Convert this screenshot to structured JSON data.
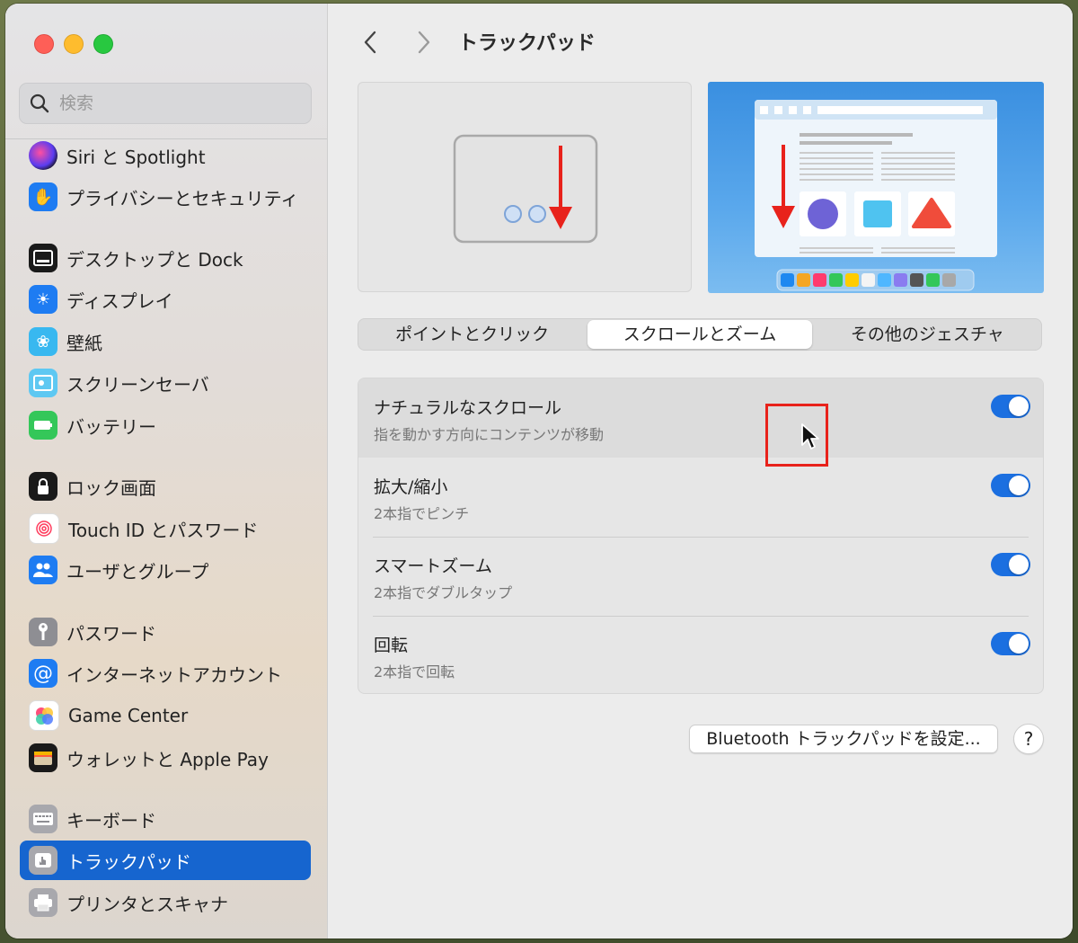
{
  "window": {
    "colors": {
      "accent": "#1665cf",
      "toggle_on": "#1b6fe0",
      "highlight_box": "#e8221b"
    }
  },
  "sidebar": {
    "search_placeholder": "検索",
    "items": [
      {
        "label": "Siri と Spotlight",
        "icon": "siri-icon",
        "selected": false
      },
      {
        "label": "プライバシーとセキュリティ",
        "icon": "hand-icon",
        "selected": false
      },
      {
        "label": "デスクトップと Dock",
        "icon": "desktop-dock-icon",
        "selected": false
      },
      {
        "label": "ディスプレイ",
        "icon": "display-brightness-icon",
        "selected": false
      },
      {
        "label": "壁紙",
        "icon": "wallpaper-flower-icon",
        "selected": false
      },
      {
        "label": "スクリーンセーバ",
        "icon": "screensaver-icon",
        "selected": false
      },
      {
        "label": "バッテリー",
        "icon": "battery-icon",
        "selected": false
      },
      {
        "label": "ロック画面",
        "icon": "lock-icon",
        "selected": false
      },
      {
        "label": "Touch ID とパスワード",
        "icon": "fingerprint-icon",
        "selected": false
      },
      {
        "label": "ユーザとグループ",
        "icon": "users-icon",
        "selected": false
      },
      {
        "label": "パスワード",
        "icon": "key-icon",
        "selected": false
      },
      {
        "label": "インターネットアカウント",
        "icon": "at-icon",
        "selected": false
      },
      {
        "label": "Game Center",
        "icon": "game-center-icon",
        "selected": false
      },
      {
        "label": "ウォレットと Apple Pay",
        "icon": "wallet-icon",
        "selected": false
      },
      {
        "label": "キーボード",
        "icon": "keyboard-icon",
        "selected": false
      },
      {
        "label": "トラックパッド",
        "icon": "trackpad-icon",
        "selected": true
      },
      {
        "label": "プリンタとスキャナ",
        "icon": "printer-icon",
        "selected": false
      }
    ]
  },
  "header": {
    "title": "トラックパッド"
  },
  "tabs": [
    {
      "label": "ポイントとクリック",
      "active": false
    },
    {
      "label": "スクロールとズーム",
      "active": true
    },
    {
      "label": "その他のジェスチャ",
      "active": false
    }
  ],
  "settings": [
    {
      "title": "ナチュラルなスクロール",
      "subtitle": "指を動かす方向にコンテンツが移動",
      "enabled": true
    },
    {
      "title": "拡大/縮小",
      "subtitle": "2本指でピンチ",
      "enabled": true
    },
    {
      "title": "スマートズーム",
      "subtitle": "2本指でダブルタップ",
      "enabled": true
    },
    {
      "title": "回転",
      "subtitle": "2本指で回転",
      "enabled": true
    }
  ],
  "footer": {
    "bluetooth_button": "Bluetooth トラックパッドを設定...",
    "help_button": "?"
  }
}
